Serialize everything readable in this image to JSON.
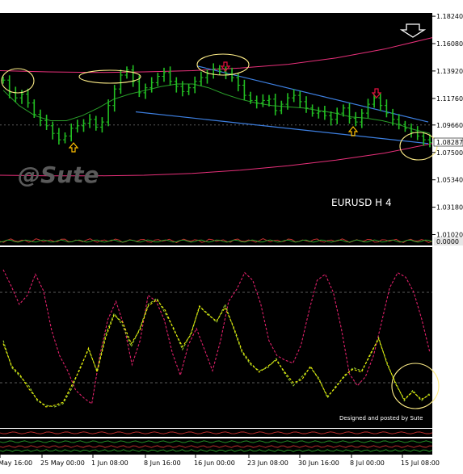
{
  "chart_data": {
    "type": "line",
    "symbol_label": "EURUSD H 4",
    "watermark": "@Sute",
    "credit": "Designed and posted by Sute",
    "price_panel": {
      "ylim": [
        1.008,
        1.185
      ],
      "yticks": [
        "1.18240",
        "1.16080",
        "1.13920",
        "1.11760",
        "1.09660",
        "1.07500",
        "1.05340",
        "1.03180",
        "1.01020"
      ],
      "ytick_values": [
        1.1824,
        1.1608,
        1.1392,
        1.1176,
        1.0966,
        1.075,
        1.0534,
        1.0318,
        1.0102
      ],
      "current_price_label": "1.08287",
      "current_price": 1.08287,
      "close": [
        1.132,
        1.122,
        1.118,
        1.121,
        1.114,
        1.105,
        1.1,
        1.096,
        1.09,
        1.085,
        1.088,
        1.094,
        1.096,
        1.098,
        1.101,
        1.095,
        1.099,
        1.112,
        1.125,
        1.136,
        1.14,
        1.131,
        1.122,
        1.126,
        1.13,
        1.135,
        1.138,
        1.131,
        1.127,
        1.123,
        1.126,
        1.131,
        1.134,
        1.137,
        1.141,
        1.139,
        1.137,
        1.134,
        1.128,
        1.12,
        1.116,
        1.114,
        1.116,
        1.117,
        1.108,
        1.113,
        1.118,
        1.12,
        1.115,
        1.11,
        1.106,
        1.107,
        1.104,
        1.101,
        1.106,
        1.11,
        1.102,
        1.099,
        1.106,
        1.113,
        1.118,
        1.112,
        1.106,
        1.101,
        1.097,
        1.094,
        1.091,
        1.088,
        1.085,
        1.08287
      ],
      "moving_average": [
        1.124,
        1.112,
        1.104,
        1.1,
        1.1,
        1.104,
        1.11,
        1.117,
        1.121,
        1.124,
        1.127,
        1.129,
        1.129,
        1.126,
        1.121,
        1.117,
        1.114,
        1.112,
        1.111,
        1.11,
        1.108,
        1.106,
        1.103,
        1.102,
        1.1,
        1.097,
        1.093,
        1.09
      ],
      "envelope_upper": [
        1.1395,
        1.1385,
        1.138,
        1.1385,
        1.1395,
        1.1415,
        1.1445,
        1.1495,
        1.1565,
        1.1655
      ],
      "envelope_lower": [
        1.057,
        1.0565,
        1.0565,
        1.057,
        1.0585,
        1.061,
        1.0645,
        1.069,
        1.0745,
        1.082
      ],
      "channel_upper": [
        1.143,
        1.099
      ],
      "channel_lower": [
        1.107,
        1.082
      ],
      "midline": 1.0966
    },
    "oscillator_panel": {
      "value_label": "0.0000"
    },
    "indicator_panel": {
      "levels": [
        20,
        80
      ],
      "ylim": [
        -10,
        110
      ],
      "series": [
        {
          "color": "#e0206a",
          "values": [
            95,
            84,
            72,
            78,
            92,
            81,
            55,
            38,
            28,
            15,
            10,
            6,
            38,
            62,
            74,
            58,
            32,
            48,
            78,
            74,
            62,
            40,
            25,
            45,
            56,
            42,
            28,
            48,
            74,
            82,
            93,
            88,
            72,
            48,
            38,
            35,
            33,
            45,
            68,
            88,
            92,
            80,
            56,
            26,
            18,
            24,
            38,
            60,
            83,
            93,
            90,
            80,
            62,
            40
          ]
        },
        {
          "color": "#9acd32",
          "values": [
            48,
            30,
            24,
            18,
            8,
            5,
            4,
            6,
            16,
            30,
            42,
            28,
            52,
            66,
            58,
            44,
            56,
            72,
            76,
            66,
            56,
            42,
            53,
            70,
            66,
            60,
            72,
            56,
            40,
            32,
            28,
            30,
            36,
            26,
            18,
            24,
            30,
            23,
            10,
            18,
            24,
            30,
            28,
            38,
            50,
            32,
            20,
            8,
            15,
            8,
            13
          ]
        },
        {
          "color": "#f0f000",
          "values": [
            46,
            31,
            25,
            16,
            9,
            4,
            5,
            7,
            18,
            29,
            43,
            27,
            50,
            65,
            60,
            46,
            55,
            71,
            75,
            68,
            55,
            44,
            52,
            71,
            65,
            61,
            70,
            57,
            41,
            33,
            27,
            31,
            35,
            27,
            20,
            22,
            31,
            22,
            11,
            17,
            25,
            29,
            27,
            39,
            49,
            33,
            19,
            9,
            14,
            9,
            12
          ]
        }
      ]
    },
    "x_tick_labels": [
      "May 16:00",
      "25 May 00:00",
      "1 Jun 08:00",
      "8 Jun 16:00",
      "16 Jun 00:00",
      "23 Jun 08:00",
      "30 Jun 16:00",
      "8 Jul 00:00",
      "15 Jul 08:00"
    ],
    "arrows": [
      {
        "kind": "up",
        "color": "#ffc000",
        "near_price": 1.089
      },
      {
        "kind": "down",
        "color": "#e81040",
        "near_price": 1.141
      },
      {
        "kind": "down",
        "color": "#e81040",
        "near_price": 1.12
      },
      {
        "kind": "up",
        "color": "#ffc000",
        "near_price": 1.094
      },
      {
        "kind": "down-outline",
        "color": "#ffffff",
        "near_price": 1.18
      }
    ],
    "colors": {
      "background": "#000000",
      "grid": "#5a5a5a",
      "price_bars": "#22c022",
      "moving_average": "#2aa02a",
      "envelope": "#e8307a",
      "channel": "#3d7fe0",
      "ellipse": "#ffee88",
      "axis_text": "#000000"
    }
  }
}
